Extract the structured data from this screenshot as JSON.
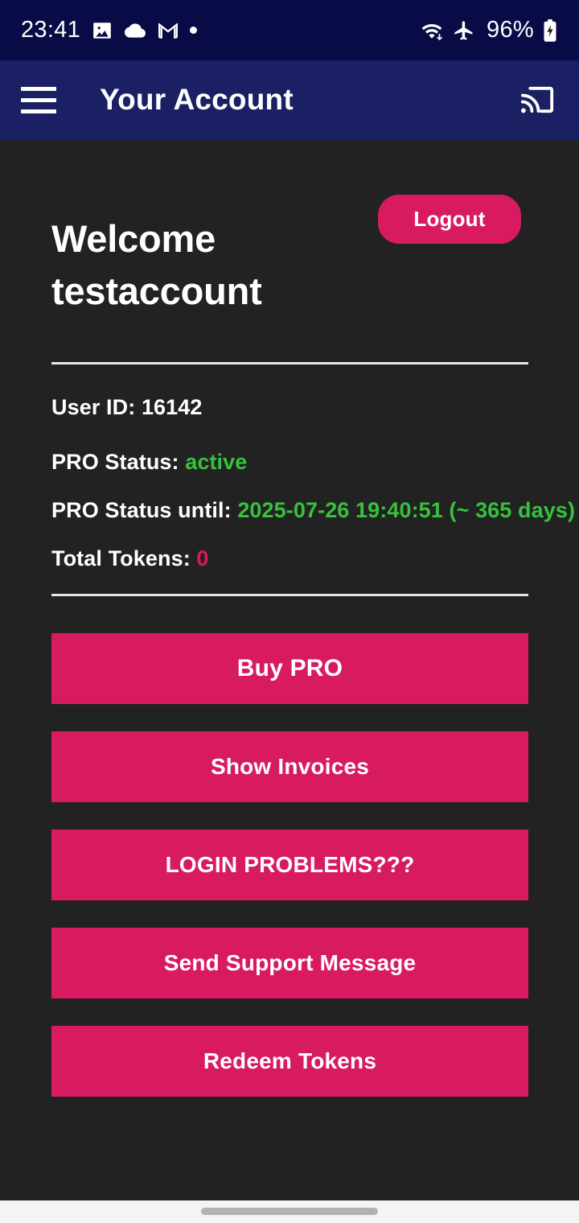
{
  "status_bar": {
    "time": "23:41",
    "battery_percent": "96%",
    "left_icons": [
      "photo-icon",
      "cloud-icon",
      "gmail-icon",
      "dot-icon"
    ],
    "right_icons": [
      "wifi-icon",
      "airplane-mode-icon",
      "battery-charging-icon"
    ],
    "background_color": "#080b45"
  },
  "app_bar": {
    "menu_icon": "hamburger-menu-icon",
    "title": "Your Account",
    "cast_icon": "cast-icon",
    "background_color": "#1b1f63"
  },
  "account": {
    "logout_label": "Logout",
    "welcome_text": "Welcome testaccount",
    "rows": [
      {
        "label": "User ID: ",
        "value": "16142",
        "value_style": "plain"
      },
      {
        "label": "PRO Status: ",
        "value": "active",
        "value_style": "green"
      },
      {
        "label": "PRO Status until: ",
        "value": "2025-07-26 19:40:51 (~ 365 days)",
        "value_style": "green"
      },
      {
        "label": "Total Tokens: ",
        "value": "0",
        "value_style": "pink"
      }
    ]
  },
  "actions": [
    {
      "label": "Buy PRO"
    },
    {
      "label": "Show Invoices"
    },
    {
      "label": "LOGIN PROBLEMS???"
    },
    {
      "label": "Send Support Message"
    },
    {
      "label": "Redeem Tokens"
    }
  ],
  "colors": {
    "accent_pink": "#d81b60",
    "status_green": "#38c13c",
    "background_dark": "#222222",
    "navbar_light": "#f4f4f4"
  }
}
